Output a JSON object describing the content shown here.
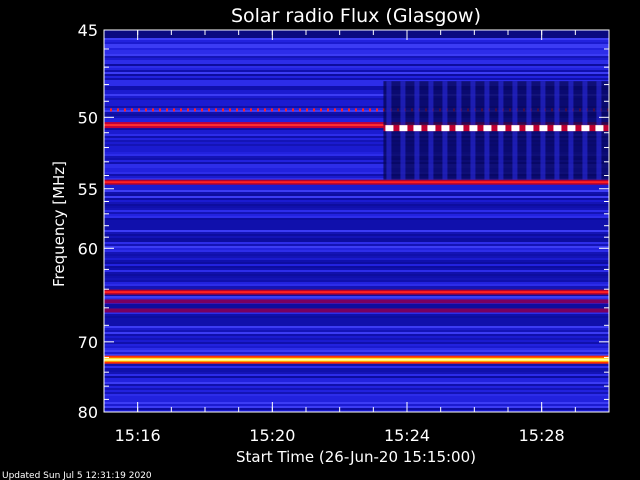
{
  "chart_data": {
    "type": "heatmap",
    "title": "Solar radio Flux (Glasgow)",
    "xlabel": "Start Time (26-Jun-20 15:15:00)",
    "ylabel": "Frequency [MHz]",
    "x_ticks": [
      "15:16",
      "15:20",
      "15:24",
      "15:28"
    ],
    "x_tick_minutes": [
      1,
      5,
      9,
      13
    ],
    "xlim_minutes": [
      0,
      15
    ],
    "y_ticks": [
      45,
      50,
      55,
      60,
      70,
      80
    ],
    "ylim": [
      45,
      80
    ],
    "y_scale": "reciprocal",
    "colormap": [
      "#0a0a8a",
      "#2020e0",
      "#5050ff",
      "#9a0050",
      "#ff2020",
      "#ffd000",
      "#ffffff"
    ],
    "bands": [
      {
        "freq": 50.5,
        "intensity": "high"
      },
      {
        "freq": 54.5,
        "intensity": "medium"
      },
      {
        "freq": 64.3,
        "intensity": "medium"
      },
      {
        "freq": 65.3,
        "intensity": "low"
      },
      {
        "freq": 66.3,
        "intensity": "low"
      },
      {
        "freq": 72.3,
        "intensity": "very-high"
      }
    ],
    "event_start_minutes": 8.3
  },
  "footer": {
    "updated": "Updated Sun Jul  5 12:31:19 2020"
  }
}
